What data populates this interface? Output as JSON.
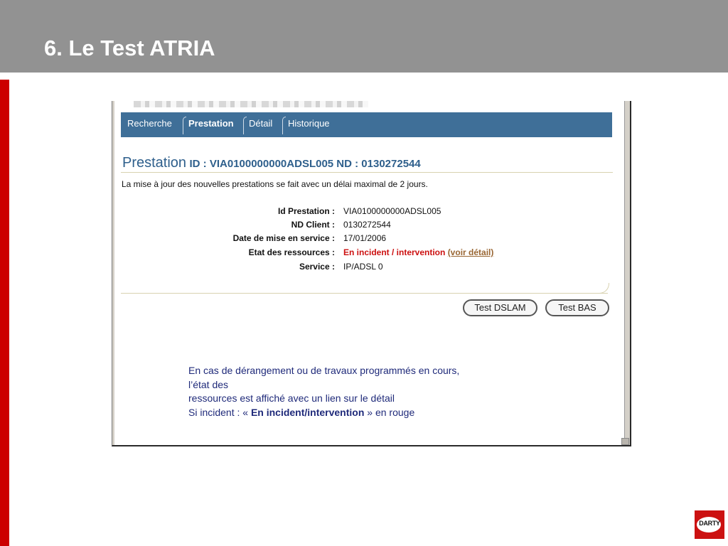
{
  "slide": {
    "title": "6. Le Test ATRIA"
  },
  "app": {
    "tabs": [
      "Recherche",
      "Prestation",
      "Détail",
      "Historique"
    ],
    "active_tab": "Prestation",
    "accent_color": "#3f6f98",
    "heading": {
      "word": "Prestation",
      "rest": "ID : VIA0100000000ADSL005 ND : 0130272544"
    },
    "notice": "La mise à jour des nouvelles prestations se fait avec un délai maximal de 2 jours.",
    "fields": [
      {
        "label": "Id Prestation :",
        "value": "VIA0100000000ADSL005"
      },
      {
        "label": "ND Client :",
        "value": "0130272544"
      },
      {
        "label": "Date de mise en service :",
        "value": "17/01/2006"
      },
      {
        "label": "Etat des ressources :",
        "value": "En incident / intervention",
        "link": "(voir détail)",
        "value_color": "#cc1111"
      },
      {
        "label": "Service :",
        "value": "IP/ADSL 0"
      }
    ],
    "buttons": {
      "test_dslam": "Test DSLAM",
      "test_bas": "Test BAS"
    }
  },
  "caption": {
    "line1": "En cas de dérangement ou de travaux programmés en cours,",
    "line2": "l’état des",
    "line3": "ressources est affiché avec un lien sur le détail",
    "line4_prefix": "Si incident : « ",
    "line4_bold": "En incident/intervention",
    "line4_suffix": " » en rouge"
  },
  "logo": {
    "text": "DARTY",
    "color": "#cc1111"
  }
}
